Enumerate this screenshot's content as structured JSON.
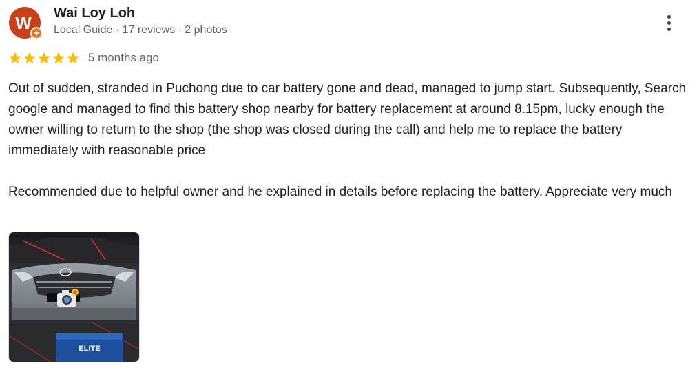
{
  "reviewer": {
    "initial": "W",
    "name": "Wai Loy Loh",
    "meta": "Local Guide · 17 reviews · 2 photos",
    "avatar_color": "#c8401a",
    "badge_color": "#e8711e"
  },
  "review": {
    "rating": 5,
    "max_rating": 5,
    "star_color": "#fbbc04",
    "date": "5 months ago",
    "paragraphs": [
      "Out of sudden, stranded in Puchong due to car battery gone and dead, managed to jump start. Subsequently, Search google and managed to find this battery shop nearby for battery replacement at around 8.15pm, lucky enough the owner willing to return to the shop (the shop was closed during the call) and help me to replace the battery immediately with reasonable price",
      "Recommended due to helpful owner and he explained in details before replacing the battery. Appreciate very much"
    ]
  },
  "photo": {
    "battery_label": "ELITE",
    "icon": "camera-flash-icon"
  },
  "menu": {
    "icon": "more-vert-icon"
  }
}
